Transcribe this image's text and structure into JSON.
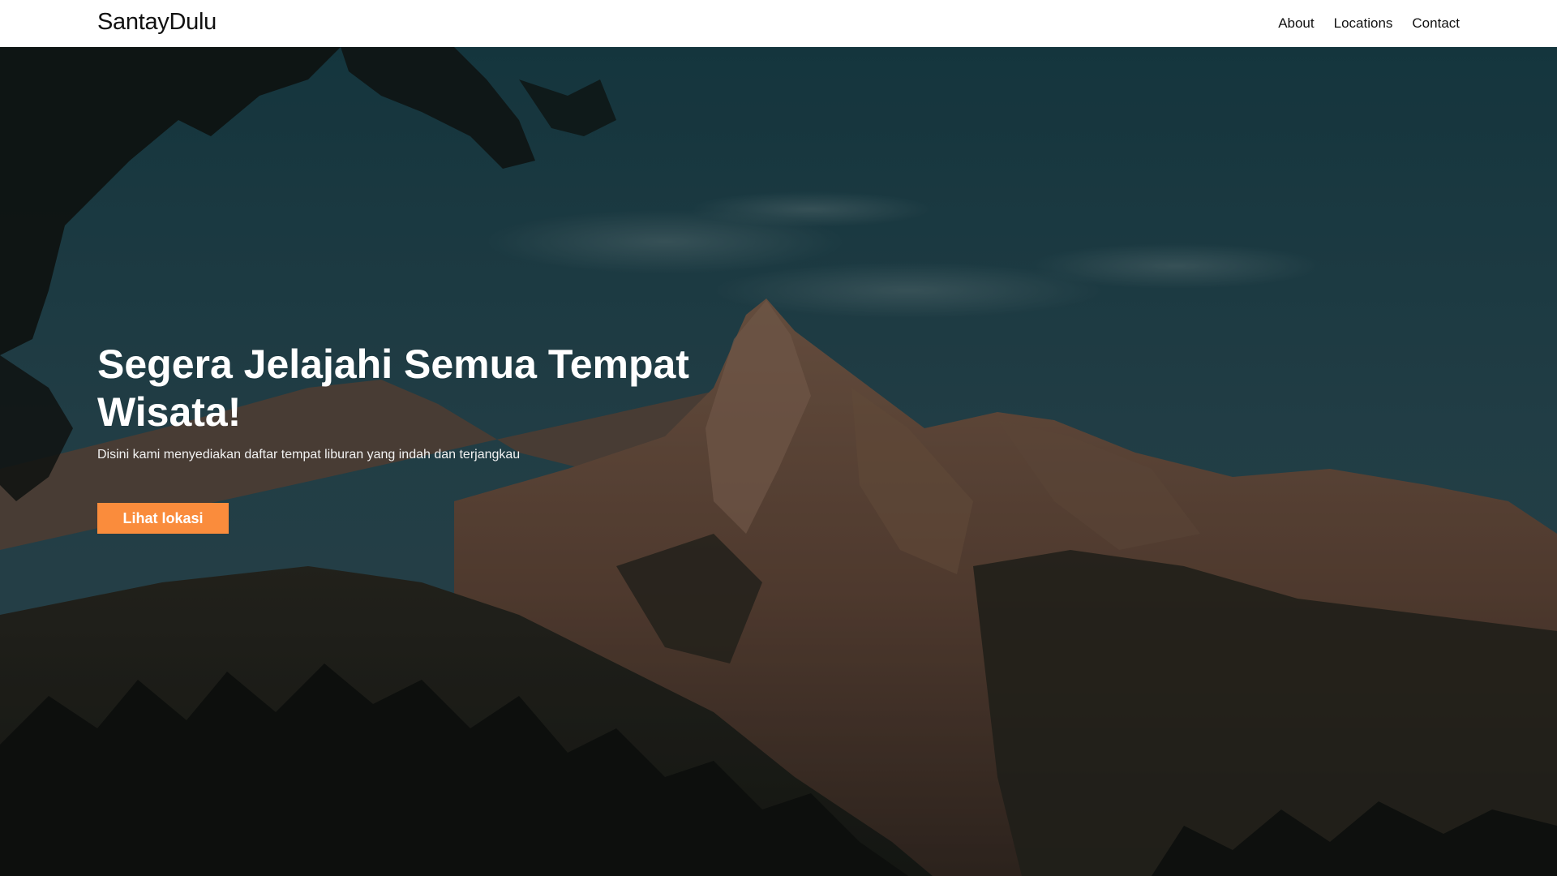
{
  "navbar": {
    "brand": "SantayDulu",
    "links": [
      {
        "label": "About"
      },
      {
        "label": "Locations"
      },
      {
        "label": "Contact"
      }
    ]
  },
  "hero": {
    "title": "Segera Jelajahi Semua Tempat Wisata!",
    "subtitle": "Disini kami menyediakan daftar tempat liburan yang indah dan terjangkau",
    "button_label": "Lihat lokasi",
    "background_image": "mountain-landscape-photo"
  },
  "colors": {
    "accent": "#fa8c3c",
    "navbar_bg": "#ffffff",
    "text_dark": "#111111"
  }
}
